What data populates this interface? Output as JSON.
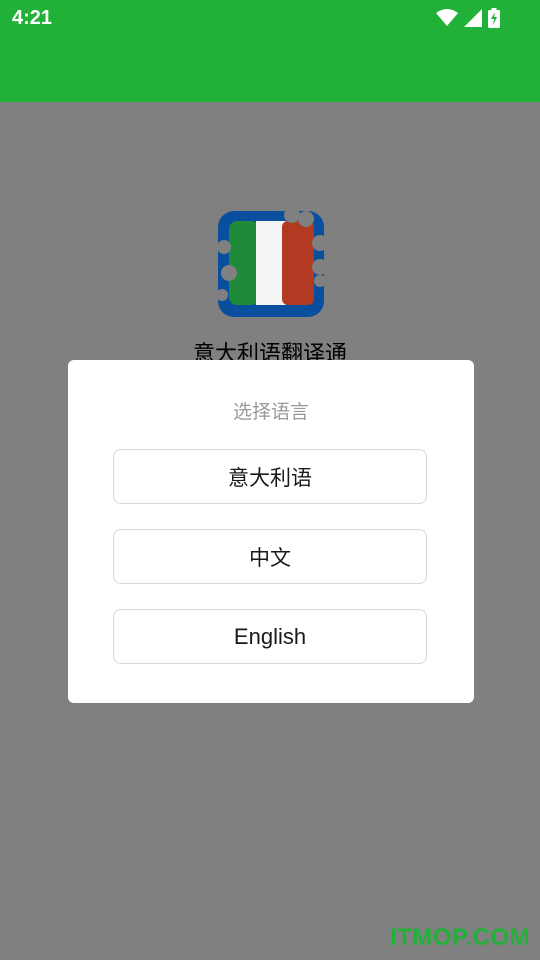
{
  "status_bar": {
    "time": "4:21",
    "icons": [
      "wifi-icon",
      "cell-signal-icon",
      "battery-charging-icon"
    ]
  },
  "splash": {
    "app_name": "意大利语翻译通",
    "logo_colors": {
      "frame": "#0a4f9e",
      "green": "#1f8a3a",
      "white": "#f4f4f4",
      "red": "#b23a23"
    }
  },
  "dialog": {
    "title": "选择语言",
    "options": [
      {
        "label": "意大利语"
      },
      {
        "label": "中文"
      },
      {
        "label": "English"
      }
    ]
  },
  "watermark": "ITMOP.COM",
  "colors": {
    "accent": "#22b138",
    "scrim": "#808080",
    "dialog_bg": "#ffffff",
    "title_text": "#999999"
  }
}
